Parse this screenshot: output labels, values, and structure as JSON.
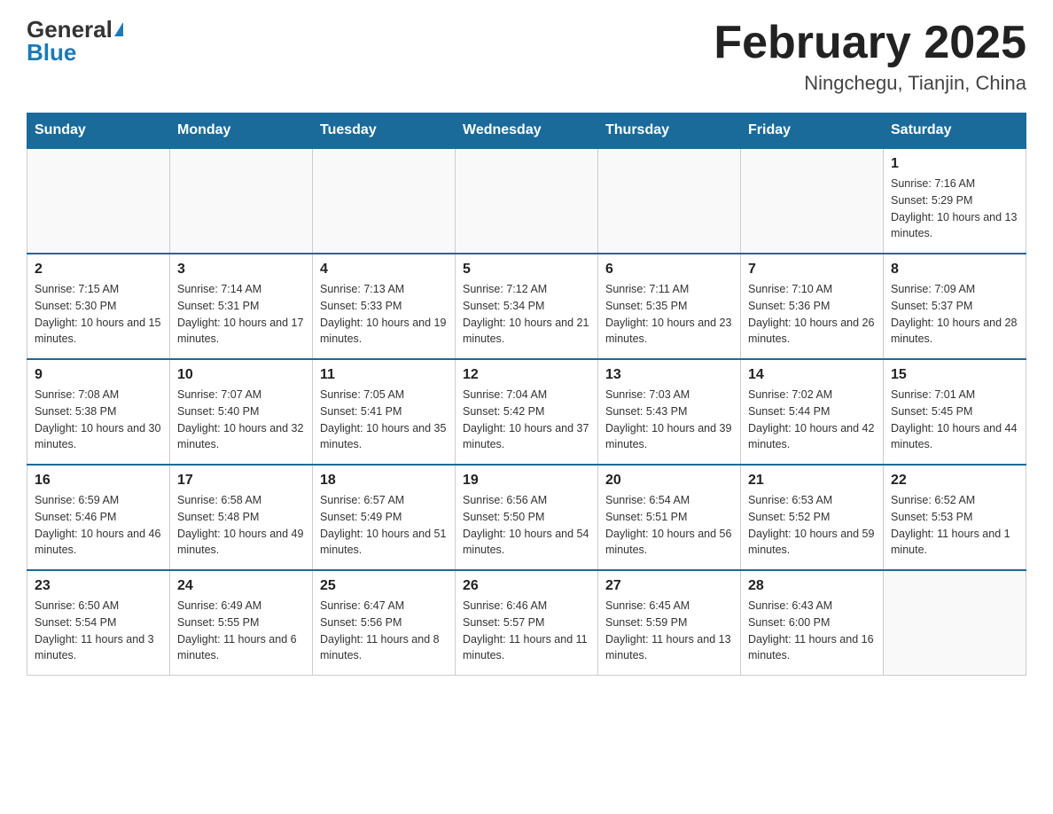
{
  "logo": {
    "general": "General",
    "blue": "Blue"
  },
  "title": "February 2025",
  "subtitle": "Ningchegu, Tianjin, China",
  "days_of_week": [
    "Sunday",
    "Monday",
    "Tuesday",
    "Wednesday",
    "Thursday",
    "Friday",
    "Saturday"
  ],
  "weeks": [
    [
      {
        "day": "",
        "info": ""
      },
      {
        "day": "",
        "info": ""
      },
      {
        "day": "",
        "info": ""
      },
      {
        "day": "",
        "info": ""
      },
      {
        "day": "",
        "info": ""
      },
      {
        "day": "",
        "info": ""
      },
      {
        "day": "1",
        "info": "Sunrise: 7:16 AM\nSunset: 5:29 PM\nDaylight: 10 hours and 13 minutes."
      }
    ],
    [
      {
        "day": "2",
        "info": "Sunrise: 7:15 AM\nSunset: 5:30 PM\nDaylight: 10 hours and 15 minutes."
      },
      {
        "day": "3",
        "info": "Sunrise: 7:14 AM\nSunset: 5:31 PM\nDaylight: 10 hours and 17 minutes."
      },
      {
        "day": "4",
        "info": "Sunrise: 7:13 AM\nSunset: 5:33 PM\nDaylight: 10 hours and 19 minutes."
      },
      {
        "day": "5",
        "info": "Sunrise: 7:12 AM\nSunset: 5:34 PM\nDaylight: 10 hours and 21 minutes."
      },
      {
        "day": "6",
        "info": "Sunrise: 7:11 AM\nSunset: 5:35 PM\nDaylight: 10 hours and 23 minutes."
      },
      {
        "day": "7",
        "info": "Sunrise: 7:10 AM\nSunset: 5:36 PM\nDaylight: 10 hours and 26 minutes."
      },
      {
        "day": "8",
        "info": "Sunrise: 7:09 AM\nSunset: 5:37 PM\nDaylight: 10 hours and 28 minutes."
      }
    ],
    [
      {
        "day": "9",
        "info": "Sunrise: 7:08 AM\nSunset: 5:38 PM\nDaylight: 10 hours and 30 minutes."
      },
      {
        "day": "10",
        "info": "Sunrise: 7:07 AM\nSunset: 5:40 PM\nDaylight: 10 hours and 32 minutes."
      },
      {
        "day": "11",
        "info": "Sunrise: 7:05 AM\nSunset: 5:41 PM\nDaylight: 10 hours and 35 minutes."
      },
      {
        "day": "12",
        "info": "Sunrise: 7:04 AM\nSunset: 5:42 PM\nDaylight: 10 hours and 37 minutes."
      },
      {
        "day": "13",
        "info": "Sunrise: 7:03 AM\nSunset: 5:43 PM\nDaylight: 10 hours and 39 minutes."
      },
      {
        "day": "14",
        "info": "Sunrise: 7:02 AM\nSunset: 5:44 PM\nDaylight: 10 hours and 42 minutes."
      },
      {
        "day": "15",
        "info": "Sunrise: 7:01 AM\nSunset: 5:45 PM\nDaylight: 10 hours and 44 minutes."
      }
    ],
    [
      {
        "day": "16",
        "info": "Sunrise: 6:59 AM\nSunset: 5:46 PM\nDaylight: 10 hours and 46 minutes."
      },
      {
        "day": "17",
        "info": "Sunrise: 6:58 AM\nSunset: 5:48 PM\nDaylight: 10 hours and 49 minutes."
      },
      {
        "day": "18",
        "info": "Sunrise: 6:57 AM\nSunset: 5:49 PM\nDaylight: 10 hours and 51 minutes."
      },
      {
        "day": "19",
        "info": "Sunrise: 6:56 AM\nSunset: 5:50 PM\nDaylight: 10 hours and 54 minutes."
      },
      {
        "day": "20",
        "info": "Sunrise: 6:54 AM\nSunset: 5:51 PM\nDaylight: 10 hours and 56 minutes."
      },
      {
        "day": "21",
        "info": "Sunrise: 6:53 AM\nSunset: 5:52 PM\nDaylight: 10 hours and 59 minutes."
      },
      {
        "day": "22",
        "info": "Sunrise: 6:52 AM\nSunset: 5:53 PM\nDaylight: 11 hours and 1 minute."
      }
    ],
    [
      {
        "day": "23",
        "info": "Sunrise: 6:50 AM\nSunset: 5:54 PM\nDaylight: 11 hours and 3 minutes."
      },
      {
        "day": "24",
        "info": "Sunrise: 6:49 AM\nSunset: 5:55 PM\nDaylight: 11 hours and 6 minutes."
      },
      {
        "day": "25",
        "info": "Sunrise: 6:47 AM\nSunset: 5:56 PM\nDaylight: 11 hours and 8 minutes."
      },
      {
        "day": "26",
        "info": "Sunrise: 6:46 AM\nSunset: 5:57 PM\nDaylight: 11 hours and 11 minutes."
      },
      {
        "day": "27",
        "info": "Sunrise: 6:45 AM\nSunset: 5:59 PM\nDaylight: 11 hours and 13 minutes."
      },
      {
        "day": "28",
        "info": "Sunrise: 6:43 AM\nSunset: 6:00 PM\nDaylight: 11 hours and 16 minutes."
      },
      {
        "day": "",
        "info": ""
      }
    ]
  ]
}
